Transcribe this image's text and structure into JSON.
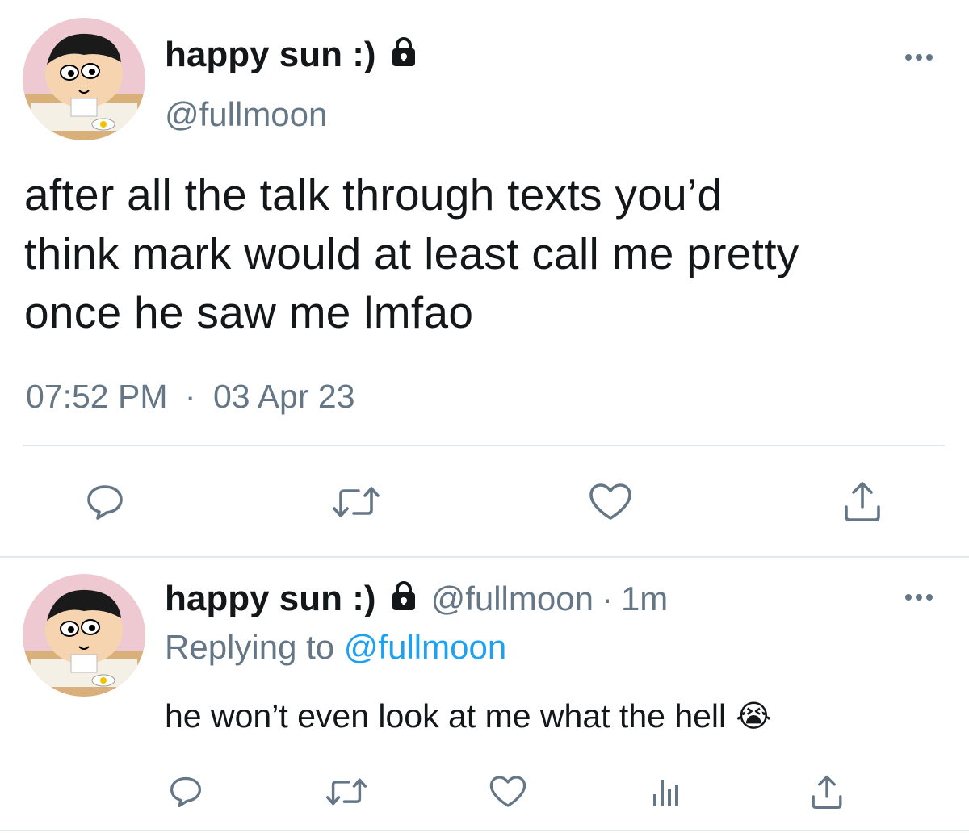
{
  "colors": {
    "text": "#14171a",
    "muted": "#657786",
    "link": "#1da1f2",
    "divider": "#e1e8ed"
  },
  "main_tweet": {
    "author_name": "happy sun :)",
    "handle": "@fullmoon",
    "text_lines": [
      "after all the talk through texts you’d",
      "think mark would at least call me pretty",
      "once he saw me lmfao"
    ],
    "time": "07:52 PM",
    "separator": "·",
    "date": "03 Apr 23",
    "actions": [
      "reply-icon",
      "retweet-icon",
      "like-icon",
      "share-icon"
    ]
  },
  "reply_tweet": {
    "author_name": "happy sun :)",
    "handle": "@fullmoon",
    "separator": "·",
    "age": "1m",
    "replying_prefix": "Replying to",
    "replying_handle": "@fullmoon",
    "text": "he won’t even look at me what the hell",
    "emoji": "😭",
    "actions": [
      "reply-icon",
      "retweet-icon",
      "like-icon",
      "analytics-icon",
      "share-icon"
    ]
  }
}
